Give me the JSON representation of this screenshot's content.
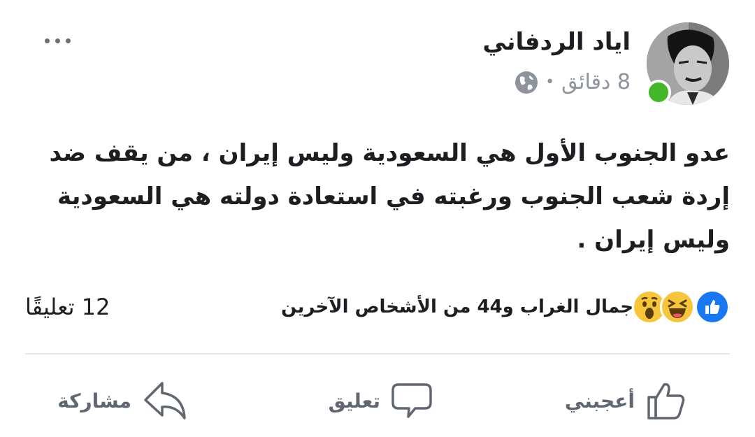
{
  "post": {
    "author": "اياد الردفاني",
    "time": "8 دقائق",
    "separator": "•",
    "privacy_icon": "globe-icon",
    "text": "عدو الجنوب الأول هي السعودية وليس إيران ، من يقف ضد إردة شعب الجنوب ورغبته في استعادة دولته هي السعودية وليس إيران .",
    "online_status_color": "#42b72a"
  },
  "reactions": {
    "icons": [
      "like-icon",
      "haha-icon",
      "wow-icon"
    ],
    "summary": "جمال الغراب و44 من الأشخاص الآخرين",
    "comments": "12 تعليقًا"
  },
  "actions": {
    "like": "أعجبني",
    "comment": "تعليق",
    "share": "مشاركة"
  }
}
